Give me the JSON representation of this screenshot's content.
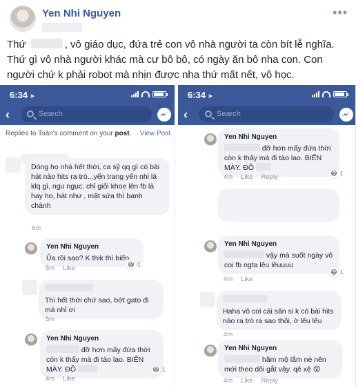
{
  "post": {
    "author": "Yen Nhi Nguyen",
    "more": "•••",
    "text_part1": "Thứ ",
    "text_part2": ", vô giáo dục, đứa trẻ con vô nhà người ta còn bít lễ nghĩa. Thứ gì vô nhà người khác mà cư bô bô, có ngày ăn bô nha con. Con người chứ k phải robot mà nhịn được nha thứ mất nết, vô học."
  },
  "phone_left": {
    "time": "6:34",
    "search_placeholder": "Search",
    "replies_prefix": "Replies to Toàn's comment on your ",
    "replies_bold": "post",
    "replies_suffix": ".",
    "view_post": "View Post",
    "comments": [
      {
        "text": "Dòng họ nhà                       hết thời, ca sỹ qq gì      có bài hát nào hits ra trò...yến trang yến nhi là klq gì, ngu ngục, chỉ giỏi khoe              lên fb là hay ho, hát như           , mặt sứa thì banh chành",
        "time": "6m"
      },
      {
        "name": "Yen Nhi Nguyen",
        "text": "Ủa rồi sao? K thik thì biến",
        "time": "5m",
        "like": "Like",
        "reaction": "😆",
        "reaction_count": "1"
      },
      {
        "text": "Thì hết thời chứ sao, bớt gato đi má nhỉ ơi",
        "time": "5m"
      },
      {
        "name": "Yen Nhi Nguyen",
        "text_a": "đỡ hơn mấy đứa thời còn k thấy mà đi tào lao. BIẾN MÀY. ĐỒ",
        "time": "4m",
        "like": "Like",
        "reaction": "😆",
        "reaction_count": "1"
      }
    ]
  },
  "phone_right": {
    "time": "6:34",
    "search_placeholder": "Search",
    "comments": [
      {
        "name": "Yen Nhi Nguyen",
        "text": "đỡ hơn mấy đứa thời còn k thấy mà đi tào lao. BIẾN MÀY. ĐỒ",
        "time": "4m",
        "like": "Like",
        "reply": "Reply",
        "reaction": "😆",
        "reaction_count": "1"
      },
      {
        "name": "Yen Nhi Nguyen",
        "text": "vậy mà suốt ngày vô coi fb ngta lêu lêuuuu",
        "time": "4m",
        "like": "Like",
        "reaction": "😆",
        "reaction_count": "1"
      },
      {
        "text": "Haha vô coi cái sân si k có bài hits nào ra trò ra sao thôi, ờ lêu lêu",
        "time": "4m"
      },
      {
        "name": "Yen Nhi Nguyen",
        "text": "hăm mộ lắm nè nên mới theo dõi gắt vậy. qê xệ",
        "time": "4m",
        "like": "Like",
        "reply": "Reply",
        "reaction": "😮"
      }
    ]
  },
  "colors": {
    "fb_blue": "#3b5998",
    "link": "#365899",
    "bubble": "#f1f2f6"
  }
}
